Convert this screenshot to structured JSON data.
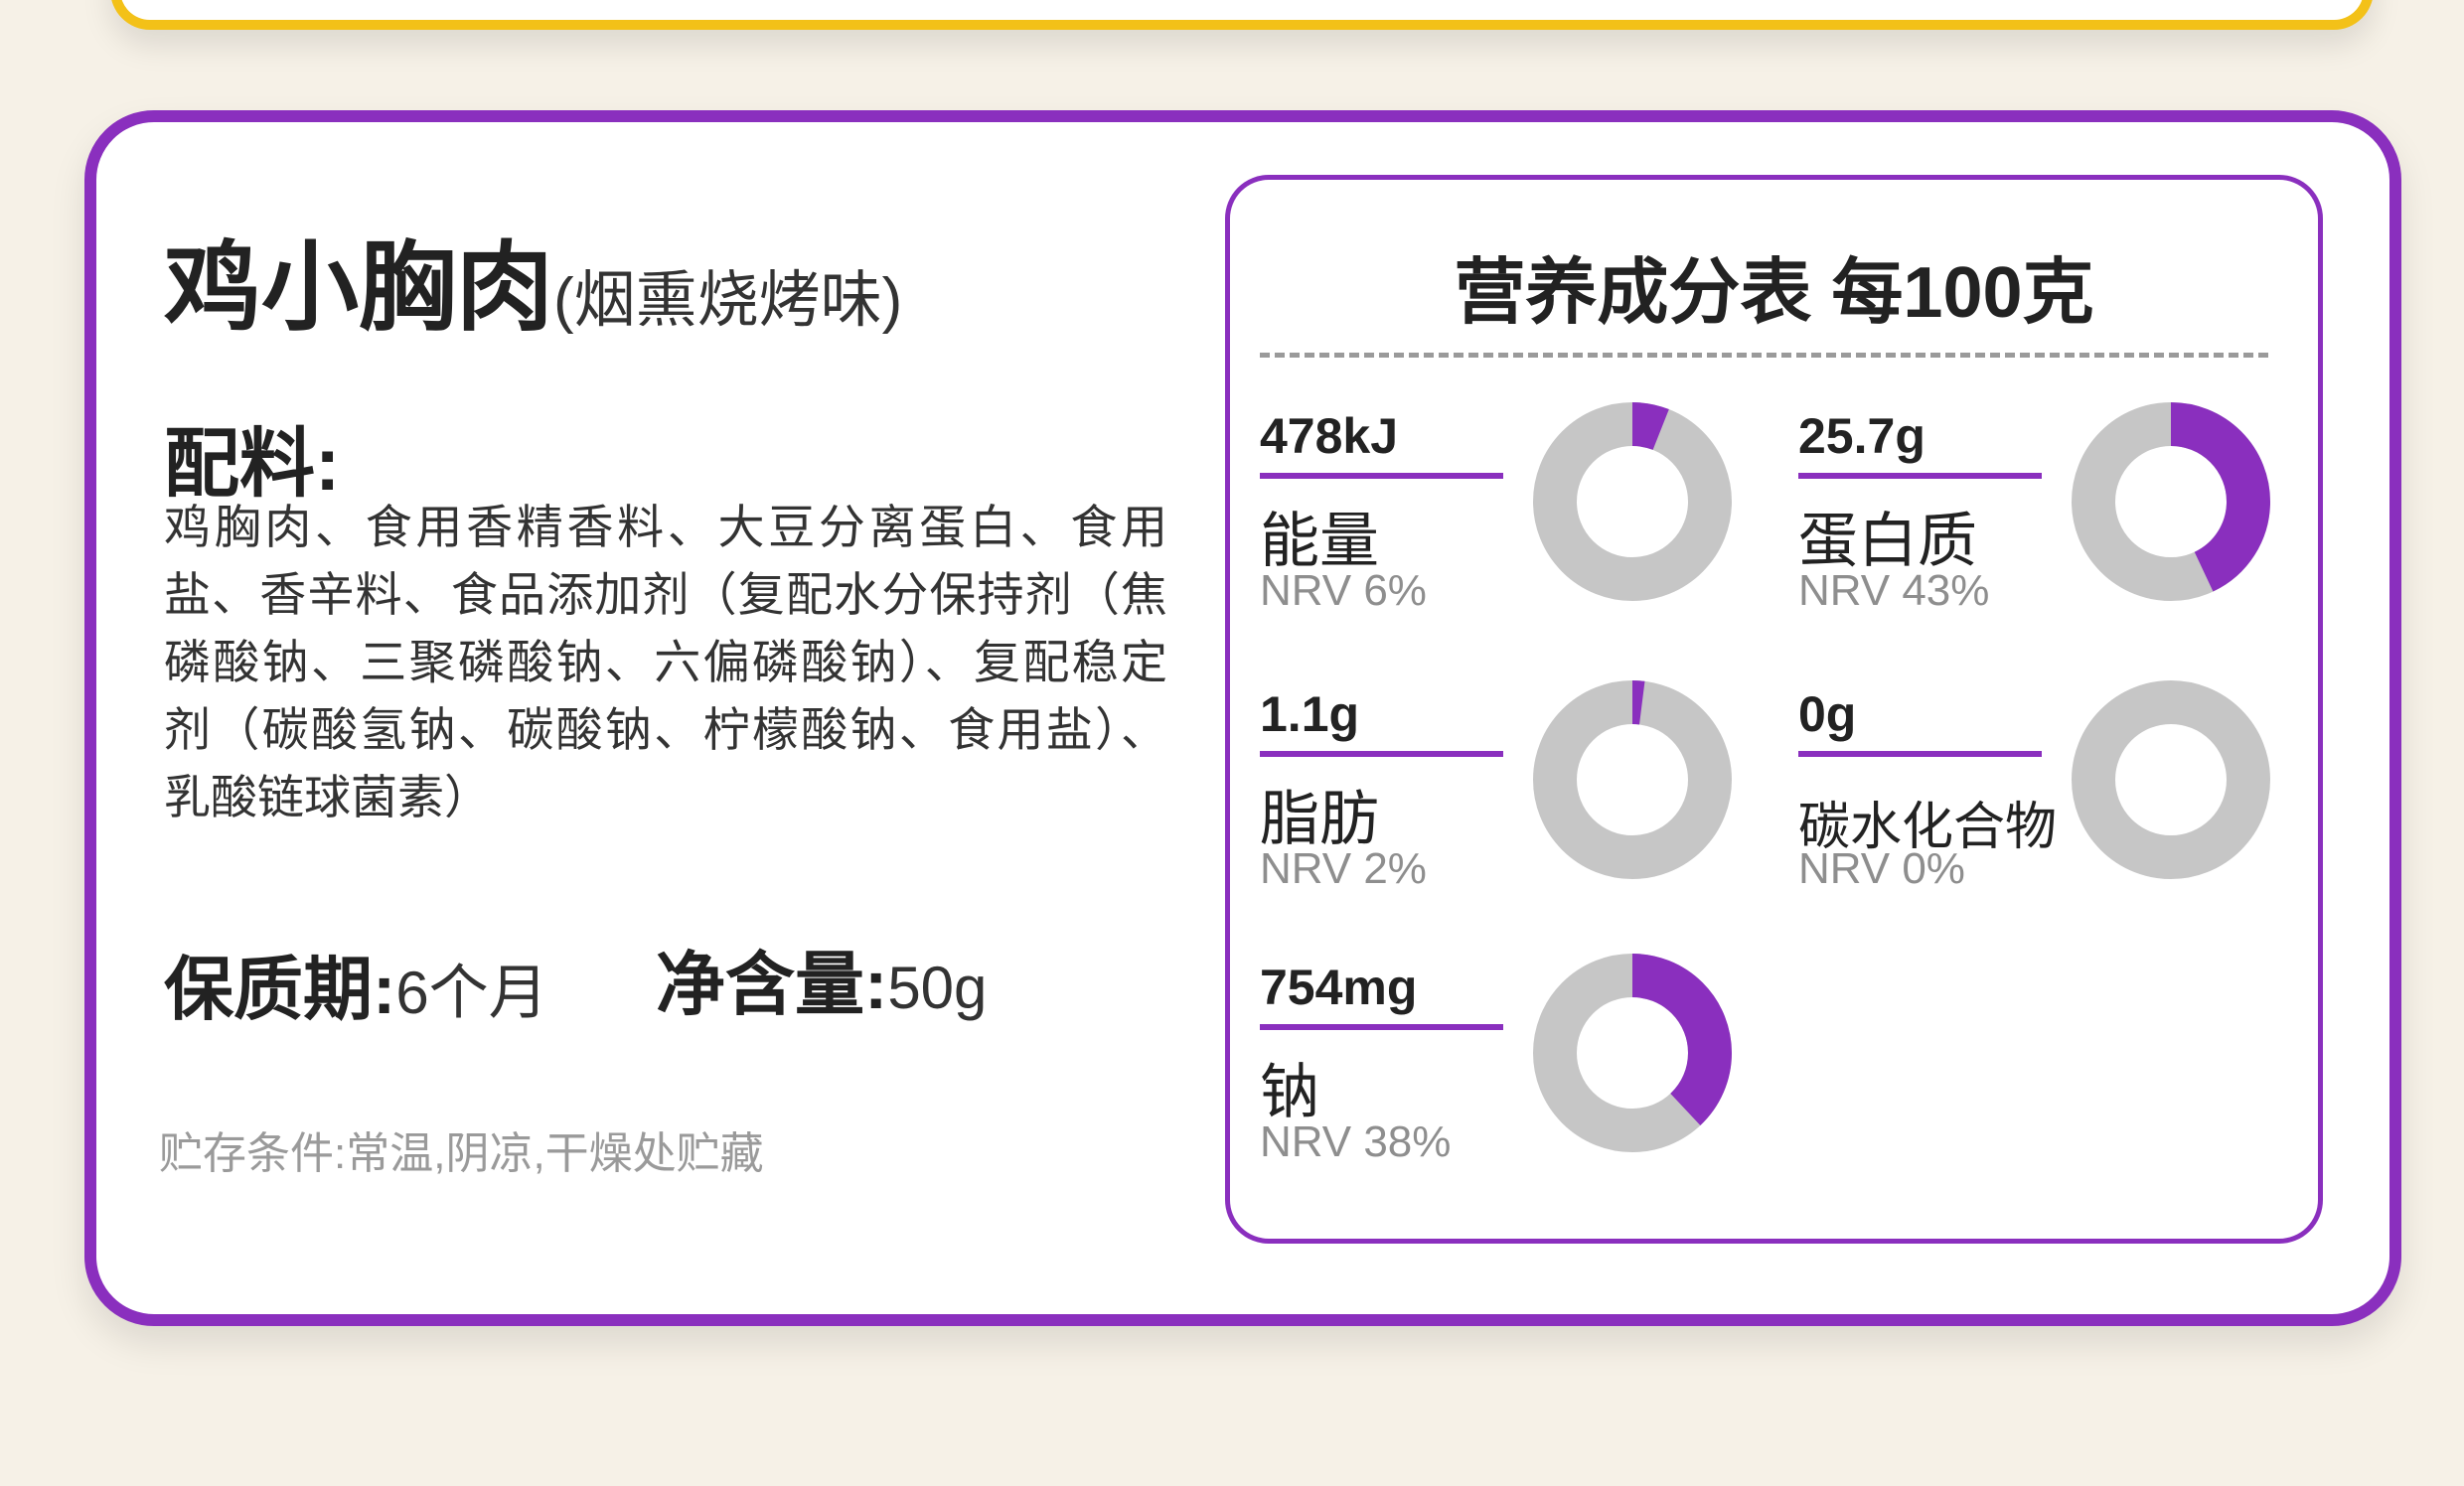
{
  "product": {
    "name": "鸡小胸肉",
    "flavor": "(烟熏烧烤味)"
  },
  "ingredients": {
    "heading": "配料:",
    "text": "鸡胸肉、食用香精香料、大豆分离蛋白、食用盐、香辛料、食品添加剂（复配水分保持剂（焦磷酸钠、三聚磷酸钠、六偏磷酸钠）、复配稳定剂（碳酸氢钠、碳酸钠、柠檬酸钠、食用盐）、乳酸链球菌素）"
  },
  "shelf_life": {
    "label": "保质期:",
    "value": "6个月"
  },
  "net_content": {
    "label": "净含量:",
    "value": "50g"
  },
  "storage": "贮存条件:常温,阴凉,干燥处贮藏",
  "nutrition": {
    "title": "营养成分表 每100克",
    "items": [
      {
        "amount": "478kJ",
        "name": "能量",
        "nrv": "NRV 6%",
        "percent": 6
      },
      {
        "amount": "25.7g",
        "name": "蛋白质",
        "nrv": "NRV 43%",
        "percent": 43
      },
      {
        "amount": "1.1g",
        "name": "脂肪",
        "nrv": "NRV 2%",
        "percent": 2
      },
      {
        "amount": "0g",
        "name": "碳水化合物",
        "nrv": "NRV 0%",
        "percent": 0
      },
      {
        "amount": "754mg",
        "name": "钠",
        "nrv": "NRV 38%",
        "percent": 38
      }
    ]
  },
  "colors": {
    "accent": "#8a2fbe",
    "top_card_border": "#f3c118",
    "donut_track": "#c6c6c6",
    "background": "#f6f1e7"
  }
}
